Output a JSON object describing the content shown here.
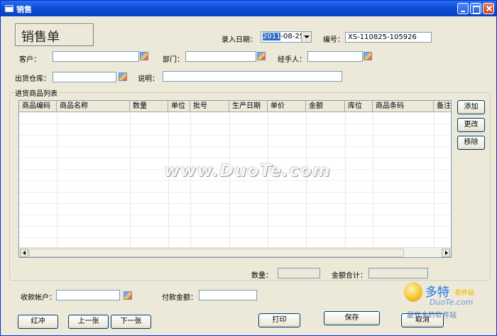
{
  "window": {
    "title": "销售"
  },
  "form": {
    "heading": "销售单",
    "entry_date_label": "录入日期：",
    "entry_date_year": "2011",
    "entry_date_rest": "-08-25",
    "number_label": "编号：",
    "number_value": "XS-110825-105926",
    "customer_label": "客户：",
    "customer_value": "",
    "department_label": "部门：",
    "department_value": "",
    "handler_label": "经手人：",
    "handler_value": "",
    "warehouse_label": "出货仓库：",
    "warehouse_value": "",
    "note_label": "说明：",
    "note_value": ""
  },
  "product_list": {
    "group_label": "进货商品列表",
    "columns": [
      "商品编码",
      "商品名称",
      "数量",
      "单位",
      "批号",
      "生产日期",
      "单价",
      "金额",
      "库位",
      "商品条码",
      "备注"
    ],
    "rows": []
  },
  "side_buttons": {
    "add": "添加",
    "edit": "更改",
    "remove": "移除"
  },
  "totals": {
    "quantity_label": "数量：",
    "quantity_value": "",
    "amount_total_label": "金额合计：",
    "amount_total_value": ""
  },
  "payment": {
    "account_label": "收款帐户：",
    "account_value": "",
    "amount_label": "付款金额：",
    "amount_value": ""
  },
  "footer_buttons": {
    "reverse": "红冲",
    "prev": "上一张",
    "next": "下一张",
    "print": "打印",
    "save": "保存",
    "cancel": "取消"
  },
  "watermark": "www.DuoTe.com",
  "brand": {
    "name": "多特",
    "sub": "软件站",
    "url": "DuoTe.com",
    "tag": "最安全的软件站"
  }
}
